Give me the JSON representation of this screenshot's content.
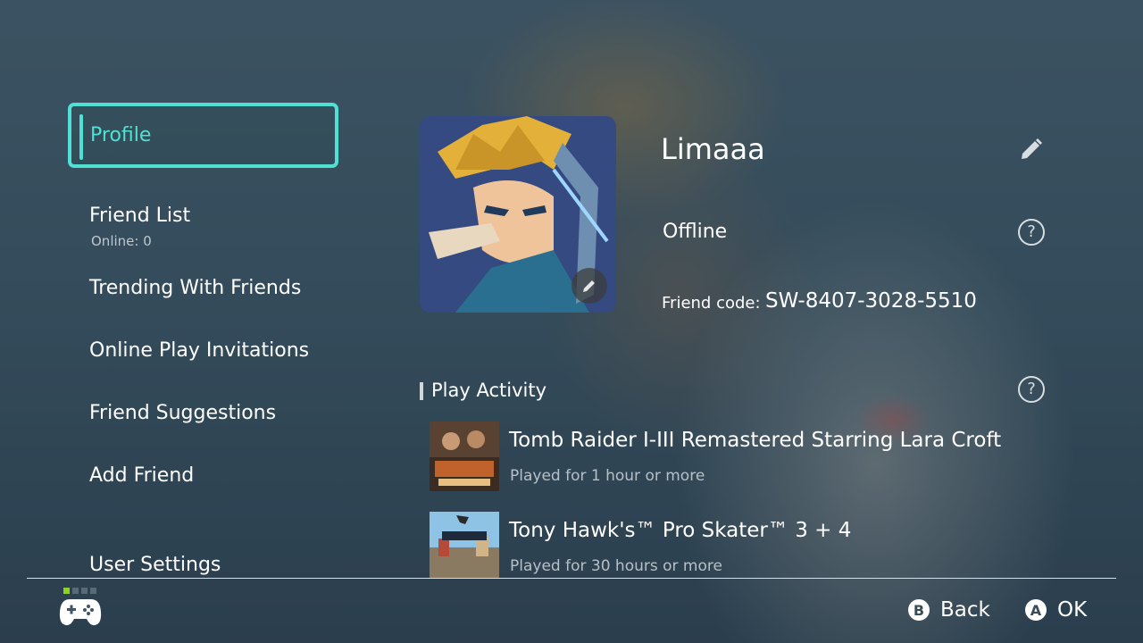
{
  "nav": {
    "selected": "Profile",
    "items": [
      {
        "label": "Friend List",
        "sub": "Online: 0"
      },
      {
        "label": "Trending With Friends"
      },
      {
        "label": "Online Play Invitations"
      },
      {
        "label": "Friend Suggestions"
      },
      {
        "label": "Add Friend"
      },
      {
        "label": "User Settings"
      }
    ]
  },
  "profile": {
    "username": "Limaaa",
    "status": "Offline",
    "friend_code_label": "Friend code:",
    "friend_code": "SW-8407-3028-5510"
  },
  "play_activity": {
    "title": "Play Activity",
    "games": [
      {
        "title": "Tomb Raider I-III Remastered Starring Lara Croft",
        "meta": "Played for 1 hour or more"
      },
      {
        "title": "Tony Hawk's™ Pro Skater™ 3 + 4",
        "meta": "Played for 30 hours or more"
      }
    ]
  },
  "footer": {
    "back_key": "B",
    "back_label": "Back",
    "ok_key": "A",
    "ok_label": "OK",
    "page_dots": 4,
    "active_dot": 1
  },
  "icons": {
    "edit": "pencil-icon",
    "help": "question-circle-icon",
    "controller": "gamepad-icon"
  },
  "colors": {
    "accent": "#4fe1d4",
    "dot_active": "#8fd11d"
  }
}
